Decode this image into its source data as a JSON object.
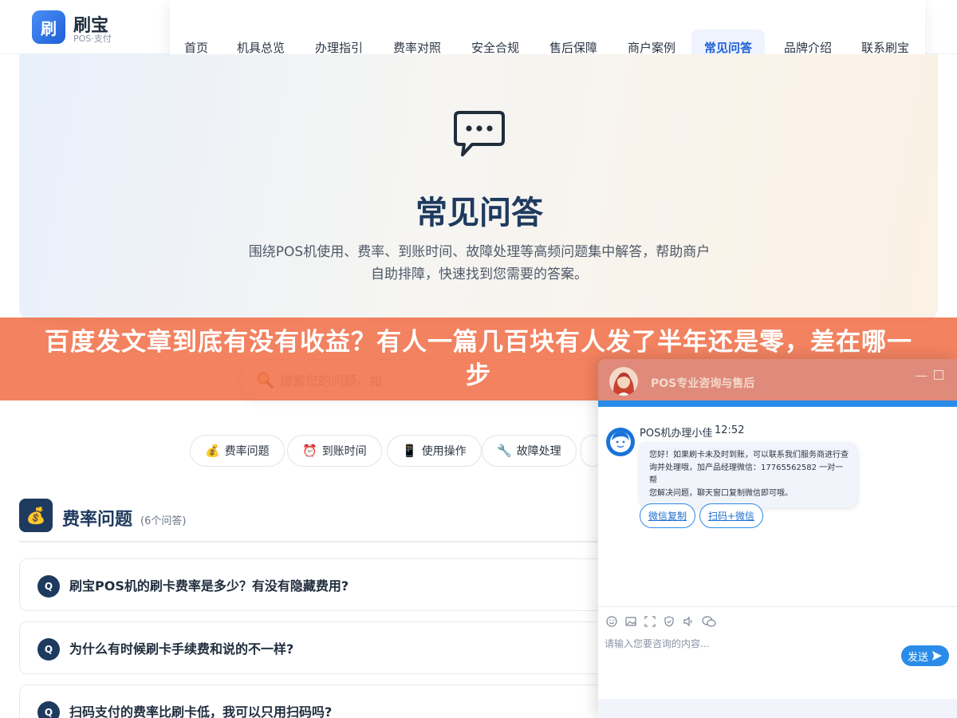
{
  "brand": {
    "name": "刷宝",
    "subtitle": "POS·支付",
    "logo_char": "刷"
  },
  "nav": {
    "items": [
      "首页",
      "机具总览",
      "办理指引",
      "费率对照",
      "安全合规",
      "售后保障",
      "商户案例",
      "常见问答",
      "品牌介绍",
      "联系刷宝"
    ],
    "active": "常见问答"
  },
  "hero": {
    "icon": "chat-bubble-icon",
    "title": "常见问答",
    "description_line1": "围绕POS机使用、费率、到账时间、故障处理等高频问题集中解答，帮助商户",
    "description_line2": "自助排障，快速找到您需要的答案。"
  },
  "search": {
    "placeholder": "搜索您的问题，如",
    "icon": "magnifier-icon"
  },
  "banner": {
    "text": "百度发文章到底有没有收益？有人一篇几百块有人发了半年还是零，差在哪一步"
  },
  "categories": [
    {
      "icon": "💰",
      "label": "费率问题"
    },
    {
      "icon": "⏰",
      "label": "到账时间"
    },
    {
      "icon": "📱",
      "label": "使用操作"
    },
    {
      "icon": "🔧",
      "label": "故障处理"
    }
  ],
  "section": {
    "icon": "💰",
    "title": "费率问题",
    "count": "(6个问答)"
  },
  "faqs": [
    {
      "badge": "Q",
      "question": "刷宝POS机的刷卡费率是多少？有没有隐藏费用?"
    },
    {
      "badge": "Q",
      "question": "为什么有时候刷卡手续费和说的不一样?"
    },
    {
      "badge": "Q",
      "question": "扫码支付的费率比刷卡低，我可以只用扫码吗?"
    }
  ],
  "chat": {
    "title": "POS专业咨询与售后",
    "agent_name": "POS机办理小佳",
    "time": "12:52",
    "message_line1": "您好！如果刷卡未及时到账，可以联系我们服务商进行查",
    "message_line2": "询并处理哦，加产品经理微信：17765562582 一对一帮",
    "message_line3": "您解决问题，聊天窗口复制微信即可哦。",
    "buttons": [
      "微信复制",
      "扫码+微信"
    ],
    "input_placeholder": "请输入您要咨询的内容...",
    "send_label": "发送",
    "colors": {
      "header": "#df8a7a",
      "accent": "#2a8ce8"
    }
  }
}
